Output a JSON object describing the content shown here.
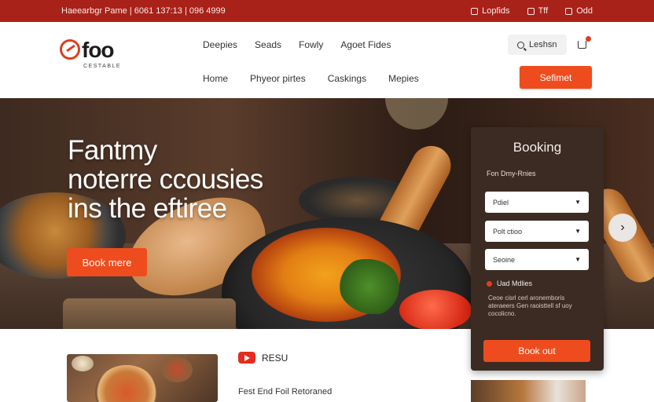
{
  "topbar": {
    "info": "Haeearbgr Pame | 6061 137:13 | 096 4999",
    "links": [
      {
        "icon": "gift-icon",
        "label": "Lopfids"
      },
      {
        "icon": "fire-icon",
        "label": "Tff"
      },
      {
        "icon": "bag-icon",
        "label": "Odd"
      }
    ]
  },
  "brand": {
    "name": "foo",
    "tagline": "CESTABLE"
  },
  "nav": {
    "primary": [
      "Deepies",
      "Seads",
      "Fowly",
      "Agoet Fides"
    ],
    "secondary": [
      "Home",
      "Phyeor pirtes",
      "Caskings",
      "Mepies"
    ]
  },
  "search": {
    "label": "Leshsn"
  },
  "header": {
    "submit_label": "Sefimet"
  },
  "hero": {
    "title_lines": [
      "Fantmy",
      "noterre ccousies",
      "ins the eftiree"
    ],
    "cta_label": "Book mere",
    "next_symbol": "›"
  },
  "booking": {
    "title": "Booking",
    "subtitle": "Fon Dmy-Rnies",
    "fields": [
      {
        "value": "Pdiel"
      },
      {
        "value": "Polt ctioo"
      },
      {
        "value": "Seoine"
      }
    ],
    "check_label": "Uad Mdlies",
    "note": "Ceoe cisrl cerl aronemboris ateraeers Gen raoisttell sf uoy cocolicno.",
    "cta_label": "Book out"
  },
  "section": {
    "title": "RESU",
    "subtitle": "Fest End Foil Retoraned"
  },
  "colors": {
    "brand_red": "#a8221a",
    "accent_orange": "#ee4c1e",
    "panel_brown": "#3b2b22"
  }
}
